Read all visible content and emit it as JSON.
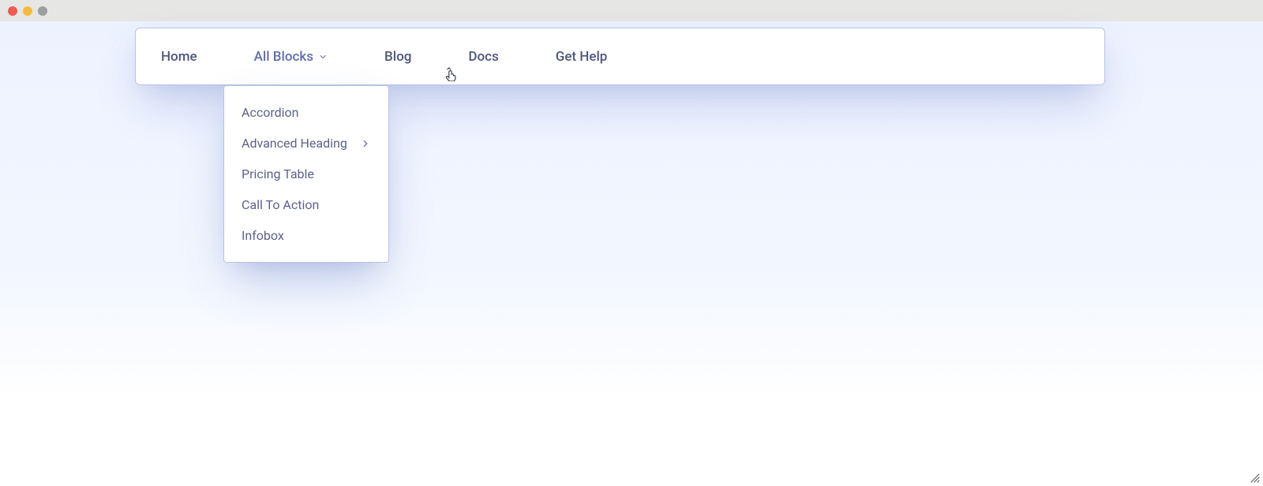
{
  "nav": {
    "items": [
      {
        "label": "Home",
        "has_submenu": false,
        "active": false
      },
      {
        "label": "All Blocks",
        "has_submenu": true,
        "active": true
      },
      {
        "label": "Blog",
        "has_submenu": false,
        "active": false
      },
      {
        "label": "Docs",
        "has_submenu": false,
        "active": false
      },
      {
        "label": "Get Help",
        "has_submenu": false,
        "active": false
      }
    ]
  },
  "dropdown": {
    "items": [
      {
        "label": "Accordion",
        "has_submenu": false
      },
      {
        "label": "Advanced Heading",
        "has_submenu": true
      },
      {
        "label": "Pricing Table",
        "has_submenu": false
      },
      {
        "label": "Call To Action",
        "has_submenu": false
      },
      {
        "label": "Infobox",
        "has_submenu": false
      }
    ]
  },
  "colors": {
    "page_bg_top": "#edf2ff",
    "nav_border": "#b9c3e8",
    "text": "#4d567d"
  }
}
